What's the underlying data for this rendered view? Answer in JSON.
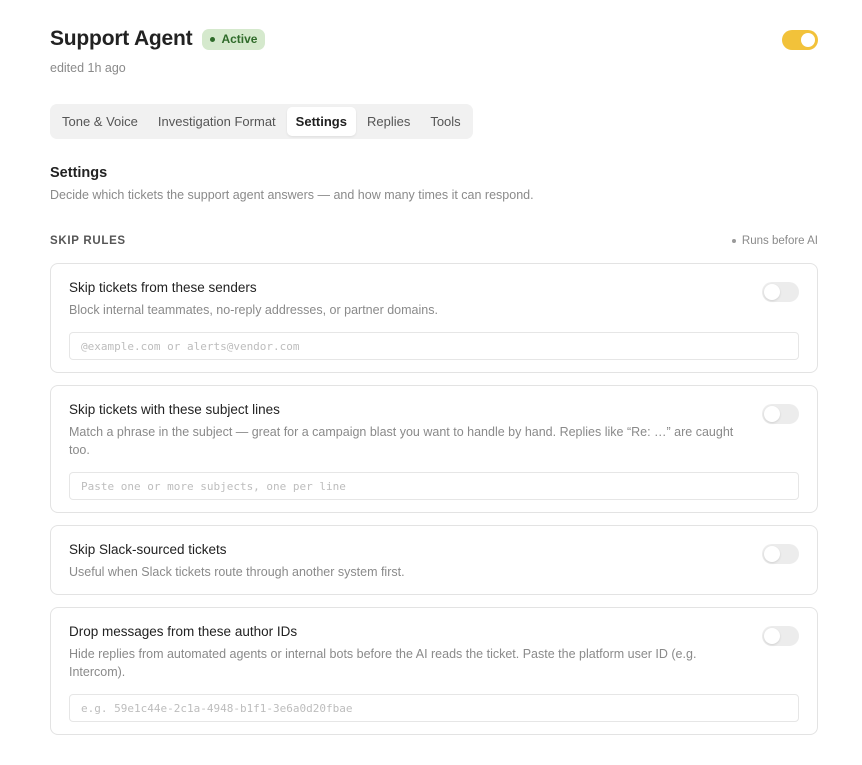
{
  "header": {
    "title": "Support Agent",
    "status_badge": "Active",
    "edited": "edited 1h ago",
    "agent_enabled": true
  },
  "tabs": [
    {
      "label": "Tone & Voice",
      "active": false
    },
    {
      "label": "Investigation Format",
      "active": false
    },
    {
      "label": "Settings",
      "active": true
    },
    {
      "label": "Replies",
      "active": false
    },
    {
      "label": "Tools",
      "active": false
    }
  ],
  "settings": {
    "title": "Settings",
    "description": "Decide which tickets the support agent answers — and how many times it can respond."
  },
  "skip_rules": {
    "label": "SKIP RULES",
    "meta": "Runs before AI",
    "rules": [
      {
        "title": "Skip tickets from these senders",
        "description": "Block internal teammates, no-reply addresses, or partner domains.",
        "enabled": false,
        "input_value": "",
        "input_placeholder": "@example.com or alerts@vendor.com"
      },
      {
        "title": "Skip tickets with these subject lines",
        "description": "Match a phrase in the subject — great for a campaign blast you want to handle by hand. Replies like “Re: …” are caught too.",
        "enabled": false,
        "input_value": "",
        "input_placeholder": "Paste one or more subjects, one per line"
      },
      {
        "title": "Skip Slack-sourced tickets",
        "description": "Useful when Slack tickets route through another system first.",
        "enabled": false
      },
      {
        "title": "Drop messages from these author IDs",
        "description": "Hide replies from automated agents or internal bots before the AI reads the ticket. Paste the platform user ID (e.g. Intercom).",
        "enabled": false,
        "input_value": "",
        "input_placeholder": "e.g. 59e1c44e-2c1a-4948-b1f1-3e6a0d20fbae"
      }
    ]
  },
  "colors": {
    "accent": "#f2c23a",
    "badge_bg": "#d5e9cd",
    "badge_text": "#2f6b2a"
  }
}
